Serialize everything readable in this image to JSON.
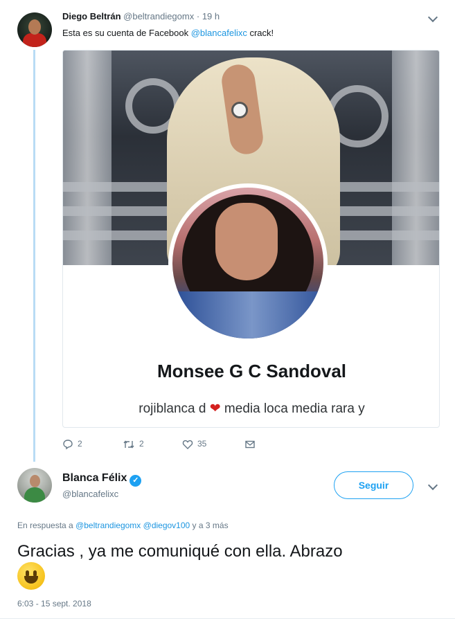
{
  "tweet1": {
    "author_name": "Diego Beltrán",
    "author_handle": "@beltrandiegomx",
    "separator": "·",
    "time": "19 h",
    "text_before": "Esta es su cuenta de Facebook ",
    "mention": "@blancafelixc",
    "text_after": " crack!",
    "card": {
      "profile_name": "Monsee G C Sandoval",
      "bio_before": "rojiblanca d",
      "bio_heart": "❤",
      "bio_after": " media loca media rara y"
    },
    "actions": {
      "replies": "2",
      "retweets": "2",
      "likes": "35",
      "icons": [
        "reply-icon",
        "retweet-icon",
        "heart-icon",
        "message-icon"
      ]
    }
  },
  "tweet2": {
    "author_name": "Blanca Félix",
    "verified_glyph": "✓",
    "author_handle": "@blancafelixc",
    "follow_label": "Seguir",
    "reply_prefix": "En respuesta a ",
    "reply_mention1": "@beltrandiegomx",
    "reply_mention2": "@diegov100",
    "reply_suffix": " y a 3 más",
    "text": "Gracias , ya me comuniqué con ella. Abrazo",
    "timestamp": "6:03 - 15 sept. 2018"
  },
  "colors": {
    "link": "#1b95e0",
    "accent": "#1da1f2",
    "muted": "#657786",
    "thread_line": "#b9dcf5",
    "heart": "#d4211f"
  }
}
